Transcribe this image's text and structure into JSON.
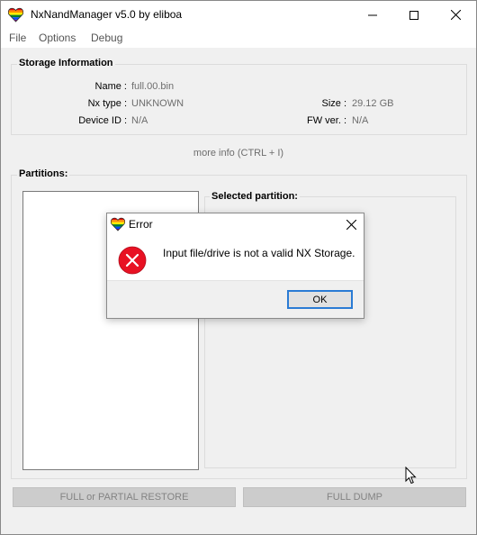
{
  "window": {
    "title": "NxNandManager v5.0 by eliboa"
  },
  "menu": [
    "File",
    "Options",
    "Debug"
  ],
  "storage": {
    "heading": "Storage Information",
    "name_label": "Name :",
    "name_value": "full.00.bin",
    "type_label": "Nx type :",
    "type_value": "UNKNOWN",
    "size_label": "Size :",
    "size_value": "29.12 GB",
    "device_label": "Device ID :",
    "device_value": "N/A",
    "fw_label": "FW ver. :",
    "fw_value": "N/A"
  },
  "more_info": "more info (CTRL + I)",
  "partitions": {
    "heading": "Partitions:",
    "selected_heading": "Selected partition:"
  },
  "buttons": {
    "restore": "FULL or PARTIAL RESTORE",
    "dump": "FULL DUMP"
  },
  "dialog": {
    "title": "Error",
    "message": "Input file/drive is not a valid NX Storage.",
    "ok_label": "OK"
  },
  "colors": {
    "error_red": "#e81123",
    "focus_blue": "#2a7bd4",
    "disabled_text": "#838383"
  }
}
